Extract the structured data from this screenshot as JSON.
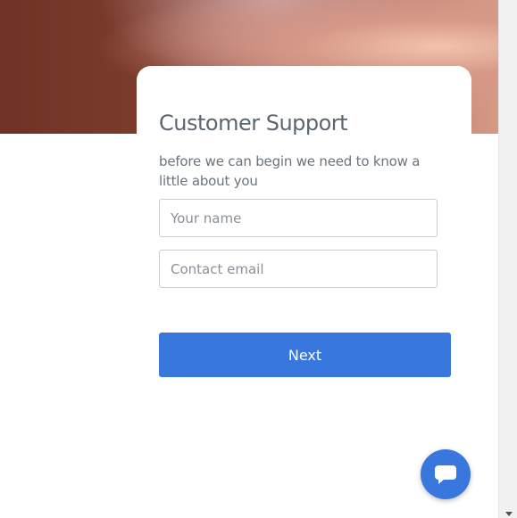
{
  "card": {
    "title": "Customer Support",
    "subtitle": "before we can begin we need to know a little about you"
  },
  "form": {
    "name_placeholder": "Your name",
    "name_value": "",
    "email_placeholder": "Contact email",
    "email_value": "",
    "next_label": "Next"
  },
  "chat_launcher": {
    "icon": "chat-bubble-icon"
  },
  "colors": {
    "accent": "#3878de",
    "title_text": "#5b6672",
    "field_border": "#c9cdd2"
  }
}
